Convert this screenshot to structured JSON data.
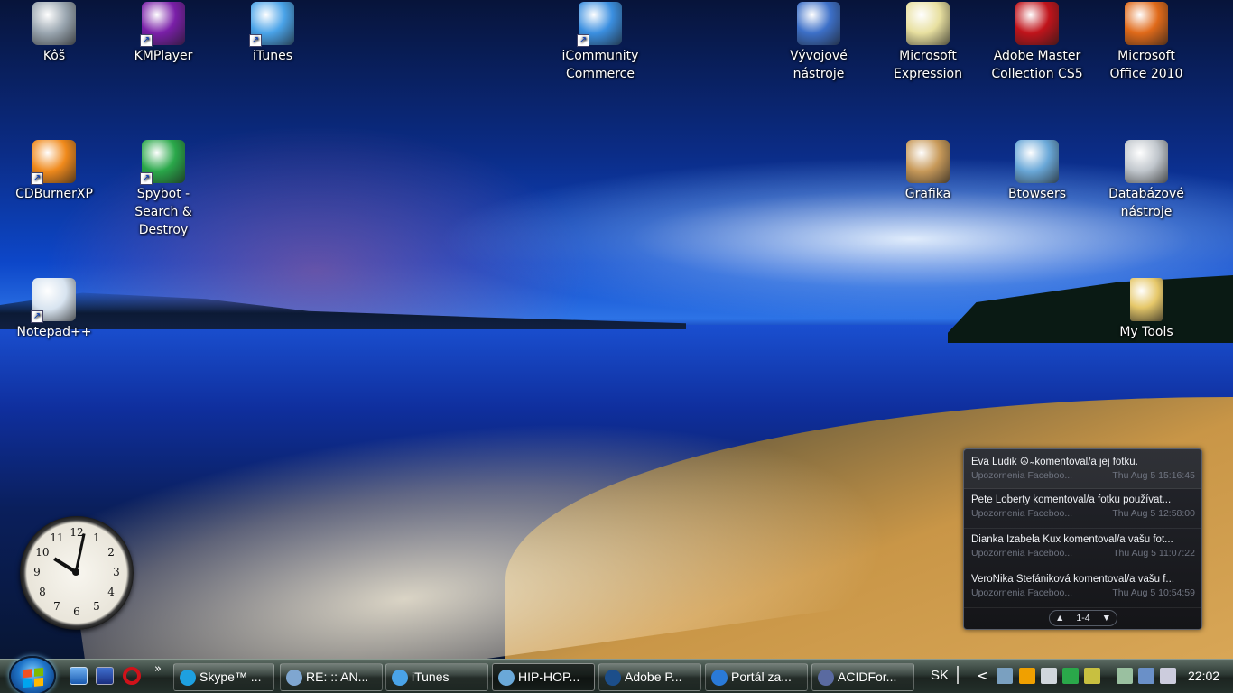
{
  "desktop": {
    "icons": [
      {
        "label": "Kôš",
        "icon": "recycle-bin-icon",
        "color": "#9aa6b0",
        "shortcut": false
      },
      {
        "label": "KMPlayer",
        "icon": "kmplayer-icon",
        "color": "#7a1fa8",
        "shortcut": true
      },
      {
        "label": "iTunes",
        "icon": "itunes-icon",
        "color": "#4aa3e8",
        "shortcut": true
      },
      {
        "label": "iCommunity Commerce",
        "icon": "globe-icon",
        "color": "#3b8fe0",
        "shortcut": true
      },
      {
        "label": "Vývojové nástroje",
        "icon": "developer-tools-icon",
        "color": "#3d70c8",
        "shortcut": false
      },
      {
        "label": "Microsoft Expression",
        "icon": "expression-icon",
        "color": "#e8e0a0",
        "shortcut": false
      },
      {
        "label": "Adobe Master Collection CS5",
        "icon": "adobe-icon",
        "color": "#c0141b",
        "shortcut": false
      },
      {
        "label": "Microsoft Office 2010",
        "icon": "office-icon",
        "color": "#e06a1a",
        "shortcut": false
      },
      {
        "label": "CDBurnerXP",
        "icon": "cdburner-icon",
        "color": "#f08a1c",
        "shortcut": true
      },
      {
        "label": "Spybot - Search & Destroy",
        "icon": "shield-icon",
        "color": "#2aa84a",
        "shortcut": true
      },
      {
        "label": "Grafika",
        "icon": "palette-icon",
        "color": "#c89a5a",
        "shortcut": false
      },
      {
        "label": "Btowsers",
        "icon": "compass-icon",
        "color": "#6aa8d8",
        "shortcut": false
      },
      {
        "label": "Databázové nástroje",
        "icon": "database-icon",
        "color": "#c0c6cc",
        "shortcut": false
      },
      {
        "label": "Notepad++",
        "icon": "notepad-icon",
        "color": "#d8e4f0",
        "shortcut": true
      },
      {
        "label": "My Tools",
        "icon": "folder-icon",
        "color": "#e6c86a",
        "shortcut": false
      }
    ]
  },
  "clock_gadget": {
    "numbers": [
      "12",
      "1",
      "2",
      "3",
      "4",
      "5",
      "6",
      "7",
      "8",
      "9",
      "10",
      "11"
    ],
    "time": "22:02"
  },
  "facebook_gadget": {
    "items": [
      {
        "text": "Eva Ludik ☮ ̴ komentoval/a jej fotku.",
        "source": "Upozornenia Faceboo...",
        "time": "Thu Aug 5 15:16:45"
      },
      {
        "text": "Pete Loberty komentoval/a fotku používat...",
        "source": "Upozornenia Faceboo...",
        "time": "Thu Aug 5 12:58:00"
      },
      {
        "text": "Dianka Izabela Kux komentoval/a vašu fot...",
        "source": "Upozornenia Faceboo...",
        "time": "Thu Aug 5 11:07:22"
      },
      {
        "text": "VeroNika Štefániková komentoval/a vašu f...",
        "source": "Upozornenia Faceboo...",
        "time": "Thu Aug 5 10:54:59"
      }
    ],
    "pager": "1-4",
    "up_glyph": "▲",
    "down_glyph": "▼"
  },
  "taskbar": {
    "quick_launch_more": "»",
    "tasks": [
      {
        "label": "Skype™ ...",
        "icon": "skype-icon",
        "color": "#1ea0e0"
      },
      {
        "label": "RE: :: AN...",
        "icon": "email-icon",
        "color": "#7fa6d0"
      },
      {
        "label": "iTunes",
        "icon": "itunes-icon",
        "color": "#4aa3e8"
      },
      {
        "label": "HIP-HOP...",
        "icon": "safari-icon",
        "color": "#6aa8d8",
        "active": true
      },
      {
        "label": "Adobe P...",
        "icon": "photoshop-icon",
        "color": "#1c4e8a"
      },
      {
        "label": "Portál za...",
        "icon": "maxthon-icon",
        "color": "#2a7ad8"
      },
      {
        "label": "ACIDFor...",
        "icon": "acid-icon",
        "color": "#5a6aa0"
      }
    ],
    "language": "SK",
    "tray_arrow": "<",
    "clock": "22:02"
  }
}
